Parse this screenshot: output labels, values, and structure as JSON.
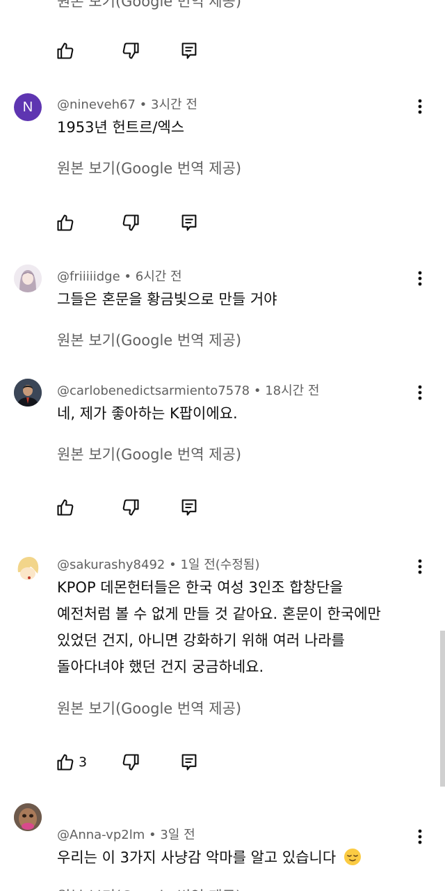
{
  "top_partial": {
    "translate_label": "원본 보기(Google 번역 제공)"
  },
  "comments": [
    {
      "handle": "@nineveh67",
      "time": "3시간 전",
      "avatar_letter": "N",
      "avatar_color": "#5e35b1",
      "lines": [
        "1953년 헌트르/엑스"
      ],
      "translate_label": "원본 보기(Google 번역 제공)"
    },
    {
      "handle": "@friiiiidge",
      "time": "6시간 전",
      "lines": [
        "그들은 혼문을 황금빛으로 만들 거야"
      ],
      "translate_label": "원본 보기(Google 번역 제공)"
    },
    {
      "handle": "@carlobenedictsarmiento7578",
      "time": "18시간 전",
      "lines": [
        "네, 제가 좋아하는 K팝이에요."
      ],
      "translate_label": "원본 보기(Google 번역 제공)"
    },
    {
      "handle": "@sakurashy8492",
      "time": "1일 전(수정됨)",
      "lines": [
        "KPOP 데몬헌터들은 한국 여성 3인조 합창단을",
        "예전처럼 볼 수 없게 만들 것 같아요. 혼문이 한국에만",
        "있었던 건지, 아니면 강화하기 위해 여러 나라를",
        "돌아다녀야 했던 건지 궁금하네요."
      ],
      "translate_label": "원본 보기(Google 번역 제공)",
      "like_count": "3"
    },
    {
      "handle": "@Anna-vp2lm",
      "time": "3일 전",
      "lines": [
        "우리는 이 3가지 사냥감 악마를 알고 있습니다"
      ],
      "translate_label": "원본 보기(Google 번역 제공)"
    }
  ],
  "separator": "•",
  "icons": {
    "like": "thumbs-up-icon",
    "dislike": "thumbs-down-icon",
    "reply": "reply-icon",
    "menu": "more-vert-icon",
    "emoji": "relieved-face-emoji"
  },
  "colors": {
    "text_primary": "#0f0f0f",
    "text_secondary": "#606060"
  }
}
